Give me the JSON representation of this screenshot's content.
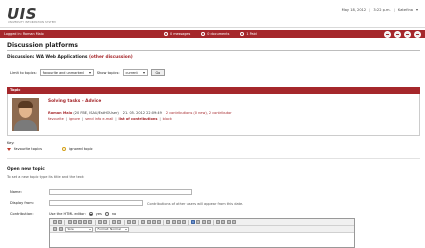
{
  "brand": {
    "logo": "UIS",
    "subtitle": "UNIVERSITY INFORMATION SYSTEM"
  },
  "topbar": {
    "date": "May 18, 2012",
    "time": "3:22 p.m.",
    "user_label": "Kateřina"
  },
  "redbar": {
    "login": "Logged in: Roman Malo",
    "messages": "0 messages",
    "documents": "0 documents",
    "count": "1 Paid"
  },
  "page": {
    "title": "Discussion platforms"
  },
  "discussion": {
    "prefix": "Discussion:",
    "name": "WA Web Applications",
    "other": "(other discussion)"
  },
  "filter": {
    "limit_label": "Limit to topics:",
    "limit_value": "favourite and unmarked",
    "show_label": "Show topics:",
    "show_value": "current",
    "go": "Go"
  },
  "topic": {
    "header": "Topic",
    "title": "Solving tasks - Advice",
    "author": "Roman Malo",
    "author_meta": "(20 FBE, ISAU/EstHOUser)",
    "date": "21. 05. 2012 22:09:49",
    "contributions": "2 contributions (0 new), 2 contributor",
    "actions": [
      "favourite",
      "ignore",
      "send info e-mail",
      "list of contributions",
      "block"
    ]
  },
  "key": {
    "label": "Key:",
    "favourite": "favourite topics",
    "ignored": "ignored topic"
  },
  "new_topic": {
    "title": "Open new topic",
    "hint": "To set a new topic type its title and the text:",
    "name_label": "Name:",
    "display_label": "Display from:",
    "display_hint": "Contributions of other users will appear from this date.",
    "contribution_label": "Contribution:",
    "html_editor_label": "Use the HTML editor:",
    "yes": "yes",
    "no": "no",
    "editor_style": "Size",
    "editor_format": "Format: Normal"
  }
}
